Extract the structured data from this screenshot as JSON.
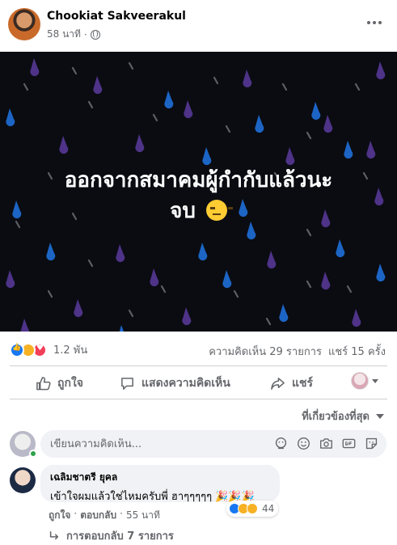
{
  "post": {
    "author": "Chookiat Sakveerakul",
    "time": "58 นาที",
    "separator": "·",
    "text_line1": "ออกจากสมาคมผู้กำกับแล้วนะ",
    "text_line2": "จบ"
  },
  "stats": {
    "reaction_count": "1.2 พัน",
    "comments": "ความคิดเห็น 29 รายการ",
    "shares": "แชร์ 15 ครั้ง"
  },
  "actions": {
    "like_label": "ถูกใจ",
    "comment_label": "แสดงความคิดเห็น",
    "share_label": "แชร์"
  },
  "sort": {
    "label": "ที่เกี่ยวข้องที่สุด"
  },
  "composer": {
    "placeholder": "เขียนความคิดเห็น..."
  },
  "comment": {
    "author": "เฉลิมชาตรี ยุคล",
    "text": "เข้าใจผมแล้วใช่ไหมครับพี่ ฮาๆๆๆๆๆ 🎉🎉🎉",
    "reaction_count": "44",
    "like_label": "ถูกใจ",
    "reply_label": "ตอบกลับ",
    "time": "55 นาที",
    "separator": "·"
  },
  "replies": {
    "label": "การตอบกลับ 7 รายการ"
  },
  "colors": {
    "accent": "#1877f2",
    "image_bg": "#0a0c12",
    "drop_purple": "#5b3b9e",
    "drop_blue": "#1e6fd9"
  }
}
